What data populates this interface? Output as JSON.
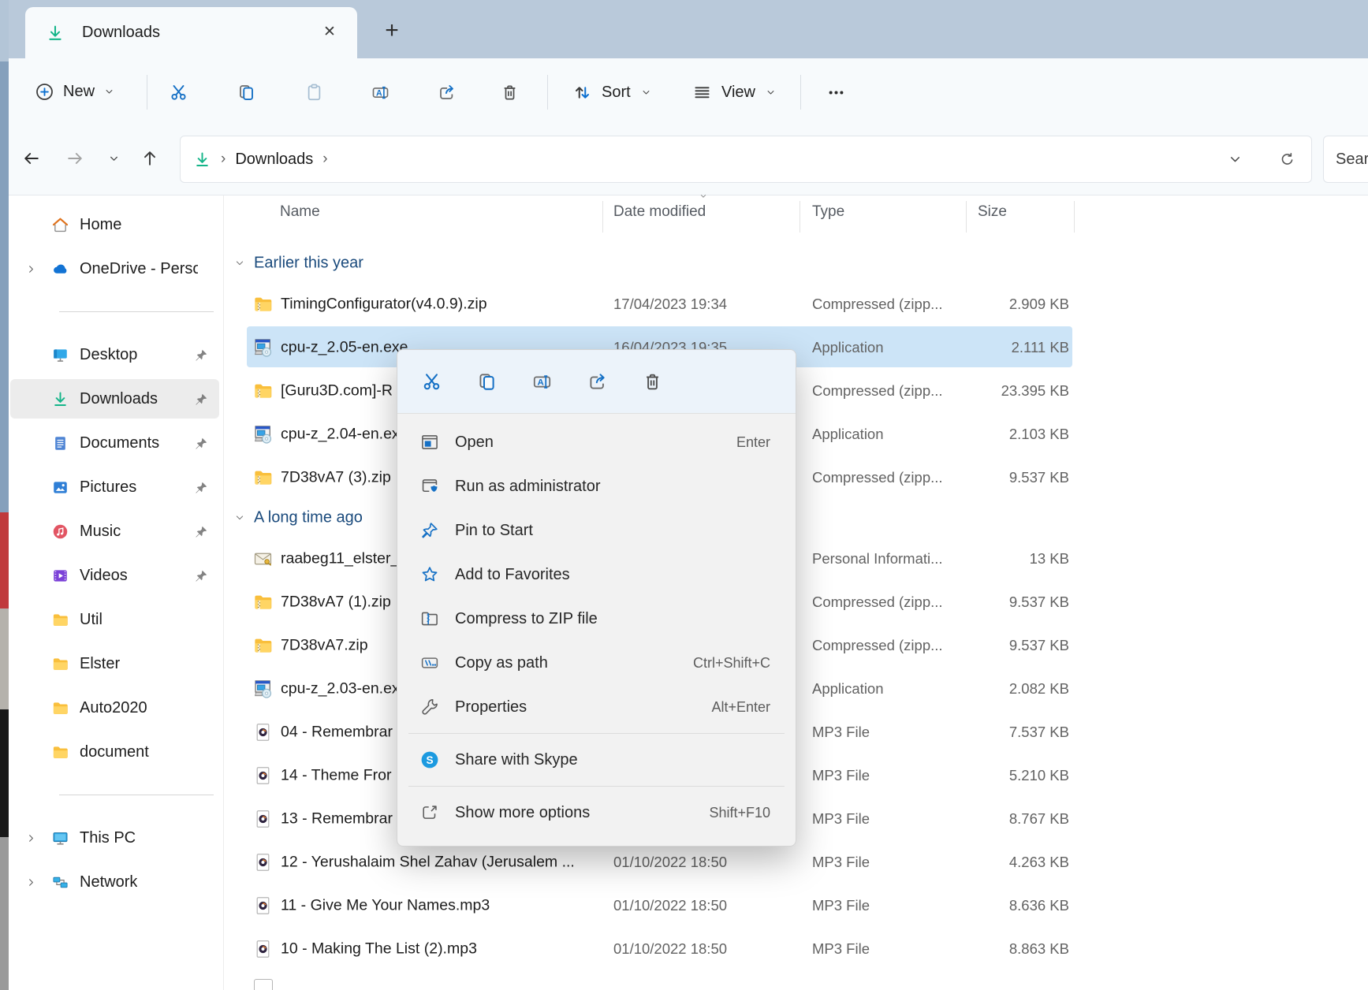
{
  "theme": {
    "accent_blue": "#1570c5",
    "selection_blue": "#cce4f7",
    "tabbar_bg": "#b9c9da",
    "group_header_text": "#1a4a7c",
    "download_icon_green": "#15b589"
  },
  "window": {
    "tab": {
      "title": "Downloads"
    },
    "toolbar": {
      "new_label": "New",
      "sort_label": "Sort",
      "view_label": "View"
    },
    "address": {
      "crumb": "Downloads",
      "search": "Searc"
    }
  },
  "sidebar": {
    "items": [
      {
        "label": "Home",
        "icon": "home"
      },
      {
        "label": "OneDrive - Persona",
        "icon": "onedrive",
        "expander": true
      },
      {
        "sep": true
      },
      {
        "label": "Desktop",
        "icon": "desktop",
        "pinned": true
      },
      {
        "label": "Downloads",
        "icon": "download",
        "pinned": true,
        "selected": true
      },
      {
        "label": "Documents",
        "icon": "documents",
        "pinned": true
      },
      {
        "label": "Pictures",
        "icon": "pictures",
        "pinned": true
      },
      {
        "label": "Music",
        "icon": "music",
        "pinned": true
      },
      {
        "label": "Videos",
        "icon": "videos",
        "pinned": true
      },
      {
        "label": "Util",
        "icon": "folder"
      },
      {
        "label": "Elster",
        "icon": "folder"
      },
      {
        "label": "Auto2020",
        "icon": "folder"
      },
      {
        "label": "document",
        "icon": "folder"
      },
      {
        "sep": true
      },
      {
        "label": "This PC",
        "icon": "thispc",
        "expander": true
      },
      {
        "label": "Network",
        "icon": "network",
        "expander": true
      }
    ]
  },
  "list": {
    "columns": [
      "Name",
      "Date modified",
      "Type",
      "Size"
    ],
    "rows": [
      {
        "kind": "group",
        "label": "Earlier this year"
      },
      {
        "kind": "file",
        "icon": "zip",
        "name": "TimingConfigurator(v4.0.9).zip",
        "date": "17/04/2023 19:34",
        "type": "Compressed (zipp...",
        "size": "2.909 KB"
      },
      {
        "kind": "file",
        "icon": "exe",
        "name": "cpu-z_2.05-en.exe",
        "date": "16/04/2023 19:35",
        "type": "Application",
        "size": "2.111 KB",
        "selected": true
      },
      {
        "kind": "file",
        "icon": "zip",
        "name": "[Guru3D.com]-R",
        "date": "",
        "type": "Compressed (zipp...",
        "size": "23.395 KB"
      },
      {
        "kind": "file",
        "icon": "exe",
        "name": "cpu-z_2.04-en.ex",
        "date": "",
        "type": "Application",
        "size": "2.103 KB"
      },
      {
        "kind": "file",
        "icon": "zip",
        "name": "7D38vA7 (3).zip",
        "date": "",
        "type": "Compressed (zipp...",
        "size": "9.537 KB"
      },
      {
        "kind": "group",
        "label": "A long time ago"
      },
      {
        "kind": "file",
        "icon": "cert",
        "name": "raabeg11_elster_",
        "date": "",
        "type": "Personal Informati...",
        "size": "13 KB"
      },
      {
        "kind": "file",
        "icon": "zip",
        "name": "7D38vA7 (1).zip",
        "date": "",
        "type": "Compressed (zipp...",
        "size": "9.537 KB"
      },
      {
        "kind": "file",
        "icon": "zip",
        "name": "7D38vA7.zip",
        "date": "",
        "type": "Compressed (zipp...",
        "size": "9.537 KB"
      },
      {
        "kind": "file",
        "icon": "exe",
        "name": "cpu-z_2.03-en.ex",
        "date": "",
        "type": "Application",
        "size": "2.082 KB"
      },
      {
        "kind": "file",
        "icon": "mp3",
        "name": "04 - Remembrar",
        "date": "",
        "type": "MP3 File",
        "size": "7.537 KB"
      },
      {
        "kind": "file",
        "icon": "mp3",
        "name": "14 - Theme Fror",
        "date": "",
        "type": "MP3 File",
        "size": "5.210 KB"
      },
      {
        "kind": "file",
        "icon": "mp3",
        "name": "13 - Remembrar",
        "date": "",
        "type": "MP3 File",
        "size": "8.767 KB"
      },
      {
        "kind": "file",
        "icon": "mp3",
        "name": "12 - Yerushalaim Shel Zahav (Jerusalem ...",
        "date": "01/10/2022 18:50",
        "type": "MP3 File",
        "size": "4.263 KB"
      },
      {
        "kind": "file",
        "icon": "mp3",
        "name": "11 - Give Me Your Names.mp3",
        "date": "01/10/2022 18:50",
        "type": "MP3 File",
        "size": "8.636 KB"
      },
      {
        "kind": "file",
        "icon": "mp3",
        "name": "10 - Making The List (2).mp3",
        "date": "01/10/2022 18:50",
        "type": "MP3 File",
        "size": "8.863 KB"
      }
    ]
  },
  "context_menu": {
    "quick_actions": [
      {
        "name": "cut",
        "icon": "cut"
      },
      {
        "name": "copy",
        "icon": "copy"
      },
      {
        "name": "rename",
        "icon": "rename"
      },
      {
        "name": "share",
        "icon": "share"
      },
      {
        "name": "delete",
        "icon": "trash"
      }
    ],
    "items": [
      {
        "icon": "open",
        "label": "Open",
        "shortcut": "Enter"
      },
      {
        "icon": "admin",
        "label": "Run as administrator"
      },
      {
        "icon": "pinblue",
        "label": "Pin to Start"
      },
      {
        "icon": "star",
        "label": "Add to Favorites"
      },
      {
        "icon": "compress",
        "label": "Compress to ZIP file"
      },
      {
        "icon": "copypath",
        "label": "Copy as path",
        "shortcut": "Ctrl+Shift+C"
      },
      {
        "icon": "wrench",
        "label": "Properties",
        "shortcut": "Alt+Enter"
      },
      {
        "sep": true
      },
      {
        "icon": "skype",
        "label": "Share with Skype"
      },
      {
        "sep": true
      },
      {
        "icon": "showmore",
        "label": "Show more options",
        "shortcut": "Shift+F10"
      }
    ]
  }
}
